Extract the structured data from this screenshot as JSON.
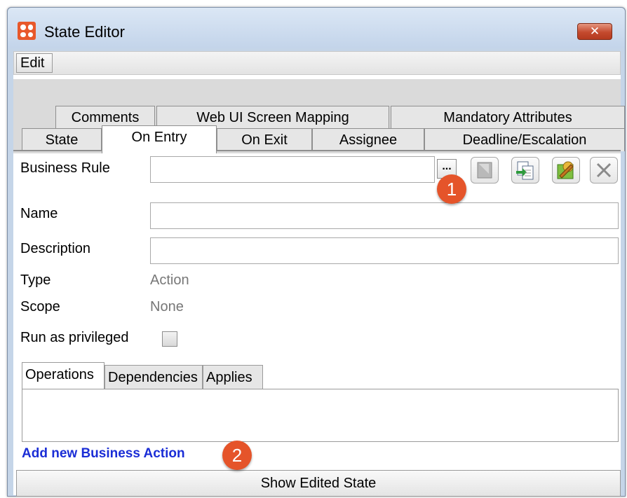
{
  "window": {
    "title": "State Editor",
    "close_glyph": "✕"
  },
  "menu": {
    "edit": "Edit"
  },
  "tabs": {
    "row1": [
      "Comments",
      "Web UI Screen Mapping",
      "Mandatory Attributes"
    ],
    "row2": [
      "State",
      "On Entry",
      "On Exit",
      "Assignee",
      "Deadline/Escalation"
    ],
    "active": "On Entry"
  },
  "form": {
    "business_rule_label": "Business Rule",
    "business_rule_value": "",
    "browse_label": "...",
    "name_label": "Name",
    "name_value": "",
    "description_label": "Description",
    "description_value": "",
    "type_label": "Type",
    "type_value": "Action",
    "scope_label": "Scope",
    "scope_value": "None",
    "run_privileged_label": "Run as privileged",
    "run_privileged_checked": false
  },
  "toolbar_icons": [
    "delete-rule-icon",
    "copy-rule-icon",
    "edit-rule-icon",
    "clear-icon"
  ],
  "subtabs": [
    "Operations",
    "Dependencies",
    "Applies if"
  ],
  "active_subtab": "Operations",
  "add_action_link": "Add new Business Action",
  "show_edited_state": "Show Edited State",
  "callouts": [
    "1",
    "2"
  ],
  "colors": {
    "callout": "#e5542a",
    "link": "#1a2dd6",
    "title_icon": "#e8582b"
  }
}
